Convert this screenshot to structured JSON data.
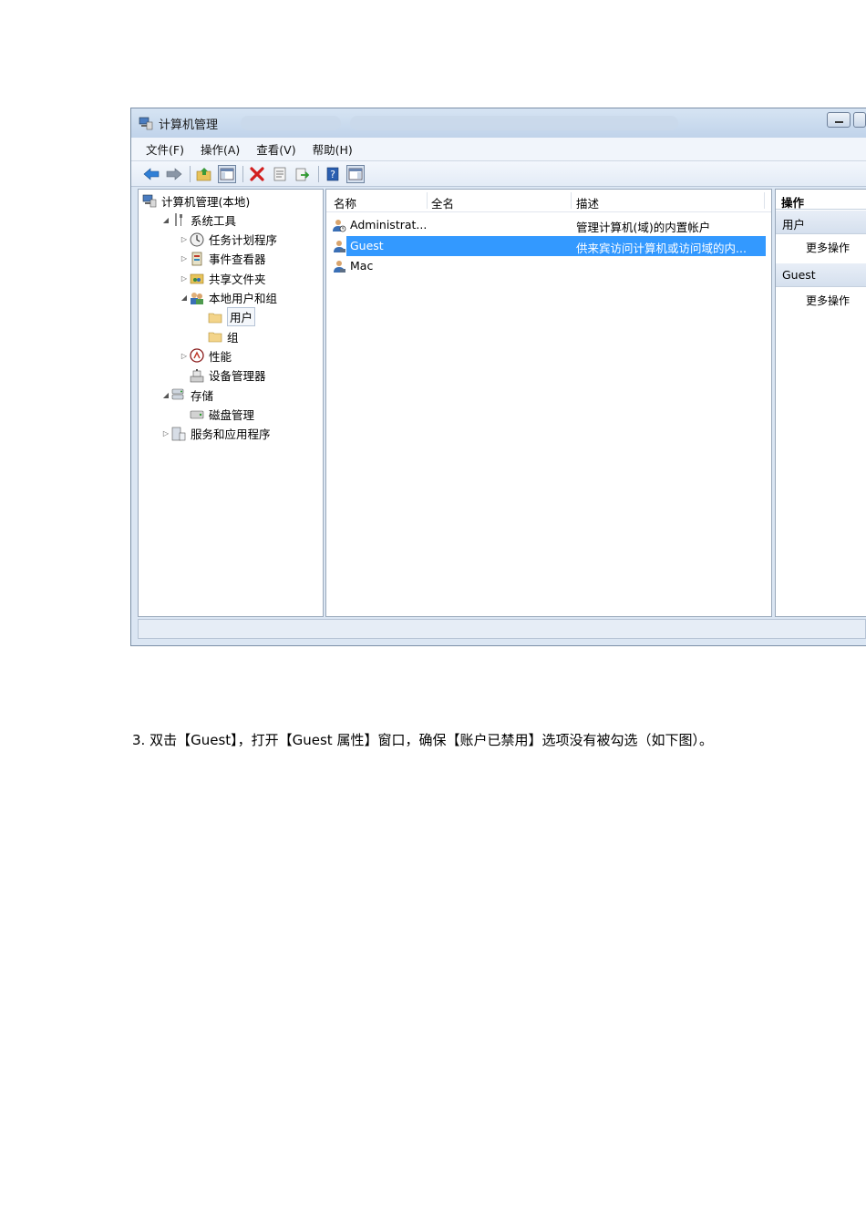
{
  "window": {
    "title": "计算机管理",
    "menu": [
      "文件(F)",
      "操作(A)",
      "查看(V)",
      "帮助(H)"
    ]
  },
  "toolbar_icons": [
    "back-arrow-icon",
    "forward-arrow-icon",
    "up-folder-icon",
    "show-hide-tree-icon",
    "delete-icon",
    "properties-icon",
    "export-icon",
    "help-icon",
    "show-hide-action-pane-icon"
  ],
  "tree": [
    {
      "label": "计算机管理(本地)",
      "level": 0,
      "arrow": "",
      "icon": "computer-management-icon"
    },
    {
      "label": "系统工具",
      "level": 1,
      "arrow": "◢",
      "icon": "system-tools-icon"
    },
    {
      "label": "任务计划程序",
      "level": 2,
      "arrow": "▷",
      "icon": "clock-icon"
    },
    {
      "label": "事件查看器",
      "level": 2,
      "arrow": "▷",
      "icon": "event-viewer-icon"
    },
    {
      "label": "共享文件夹",
      "level": 2,
      "arrow": "▷",
      "icon": "shared-folder-icon"
    },
    {
      "label": "本地用户和组",
      "level": 2,
      "arrow": "◢",
      "icon": "users-groups-icon"
    },
    {
      "label": "用户",
      "level": 3,
      "arrow": "",
      "icon": "folder-icon",
      "selected": true
    },
    {
      "label": "组",
      "level": 3,
      "arrow": "",
      "icon": "folder-icon"
    },
    {
      "label": "性能",
      "level": 2,
      "arrow": "▷",
      "icon": "performance-icon"
    },
    {
      "label": "设备管理器",
      "level": 2,
      "arrow": "",
      "icon": "device-manager-icon"
    },
    {
      "label": "存储",
      "level": 1,
      "arrow": "◢",
      "icon": "storage-icon"
    },
    {
      "label": "磁盘管理",
      "level": 2,
      "arrow": "",
      "icon": "disk-icon"
    },
    {
      "label": "服务和应用程序",
      "level": 1,
      "arrow": "▷",
      "icon": "services-icon"
    }
  ],
  "list": {
    "columns": [
      "名称",
      "全名",
      "描述"
    ],
    "rows": [
      {
        "name": "Administrat...",
        "fullname": "",
        "description": "管理计算机(域)的内置帐户",
        "icon": "admin-user-icon"
      },
      {
        "name": "Guest",
        "fullname": "",
        "description": "供来宾访问计算机或访问域的内...",
        "icon": "user-icon",
        "selected": true
      },
      {
        "name": "Mac",
        "fullname": "",
        "description": "",
        "icon": "user-icon"
      }
    ]
  },
  "actions": {
    "header": "操作",
    "sections": [
      {
        "title": "用户",
        "item": "更多操作"
      },
      {
        "title": "Guest",
        "item": "更多操作"
      }
    ]
  },
  "caption": "3. 双击【Guest】，打开【Guest 属性】窗口，确保【账户已禁用】选项没有被勾选（如下图）。"
}
